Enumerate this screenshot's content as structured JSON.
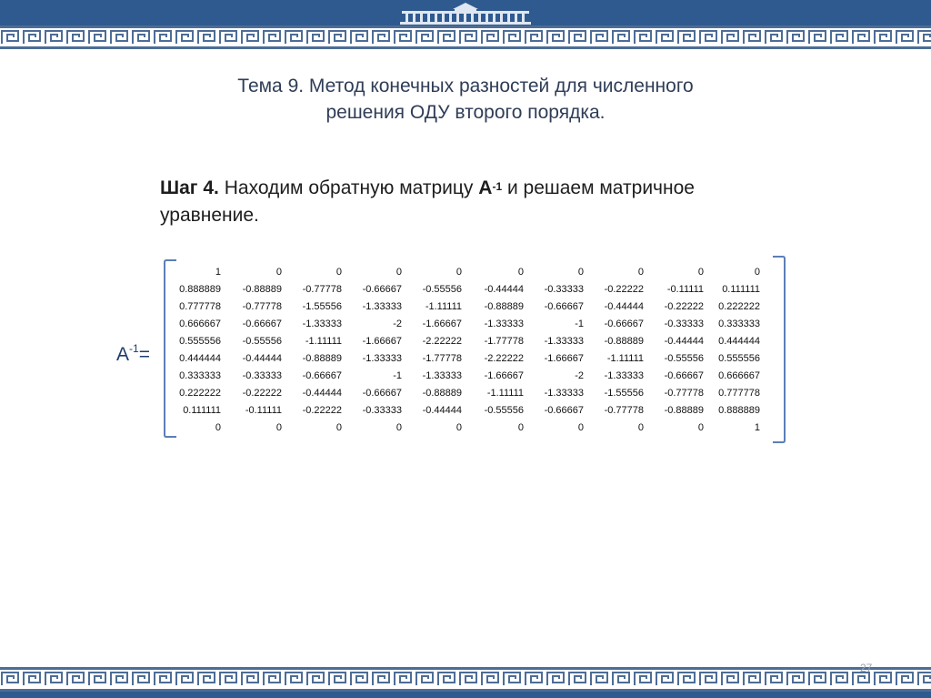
{
  "slide": {
    "title_line1": "Тема 9. Метод конечных разностей для численного",
    "title_line2": "решения ОДУ второго порядка.",
    "step_label": "Шаг 4.",
    "step_text1": "Находим обратную матрицу",
    "step_matrix": "A",
    "step_sup": "-1",
    "step_text2": "и решаем матричное",
    "step_text3": "уравнение.",
    "matrix_label": "A",
    "matrix_label_sup": "-1",
    "matrix_label_eq": "=",
    "page_number": "27"
  },
  "matrix": [
    [
      "1",
      "0",
      "0",
      "0",
      "0",
      "0",
      "0",
      "0",
      "0",
      "0"
    ],
    [
      "0.888889",
      "-0.88889",
      "-0.77778",
      "-0.66667",
      "-0.55556",
      "-0.44444",
      "-0.33333",
      "-0.22222",
      "-0.11111",
      "0.111111"
    ],
    [
      "0.777778",
      "-0.77778",
      "-1.55556",
      "-1.33333",
      "-1.11111",
      "-0.88889",
      "-0.66667",
      "-0.44444",
      "-0.22222",
      "0.222222"
    ],
    [
      "0.666667",
      "-0.66667",
      "-1.33333",
      "-2",
      "-1.66667",
      "-1.33333",
      "-1",
      "-0.66667",
      "-0.33333",
      "0.333333"
    ],
    [
      "0.555556",
      "-0.55556",
      "-1.11111",
      "-1.66667",
      "-2.22222",
      "-1.77778",
      "-1.33333",
      "-0.88889",
      "-0.44444",
      "0.444444"
    ],
    [
      "0.444444",
      "-0.44444",
      "-0.88889",
      "-1.33333",
      "-1.77778",
      "-2.22222",
      "-1.66667",
      "-1.11111",
      "-0.55556",
      "0.555556"
    ],
    [
      "0.333333",
      "-0.33333",
      "-0.66667",
      "-1",
      "-1.33333",
      "-1.66667",
      "-2",
      "-1.33333",
      "-0.66667",
      "0.666667"
    ],
    [
      "0.222222",
      "-0.22222",
      "-0.44444",
      "-0.66667",
      "-0.88889",
      "-1.11111",
      "-1.33333",
      "-1.55556",
      "-0.77778",
      "0.777778"
    ],
    [
      "0.111111",
      "-0.11111",
      "-0.22222",
      "-0.33333",
      "-0.44444",
      "-0.55556",
      "-0.66667",
      "-0.77778",
      "-0.88889",
      "0.888889"
    ],
    [
      "0",
      "0",
      "0",
      "0",
      "0",
      "0",
      "0",
      "0",
      "0",
      "1"
    ]
  ],
  "colors": {
    "header": "#2f5a8f",
    "border_pattern": "#4d6d96",
    "bracket": "#5b7fb8"
  }
}
